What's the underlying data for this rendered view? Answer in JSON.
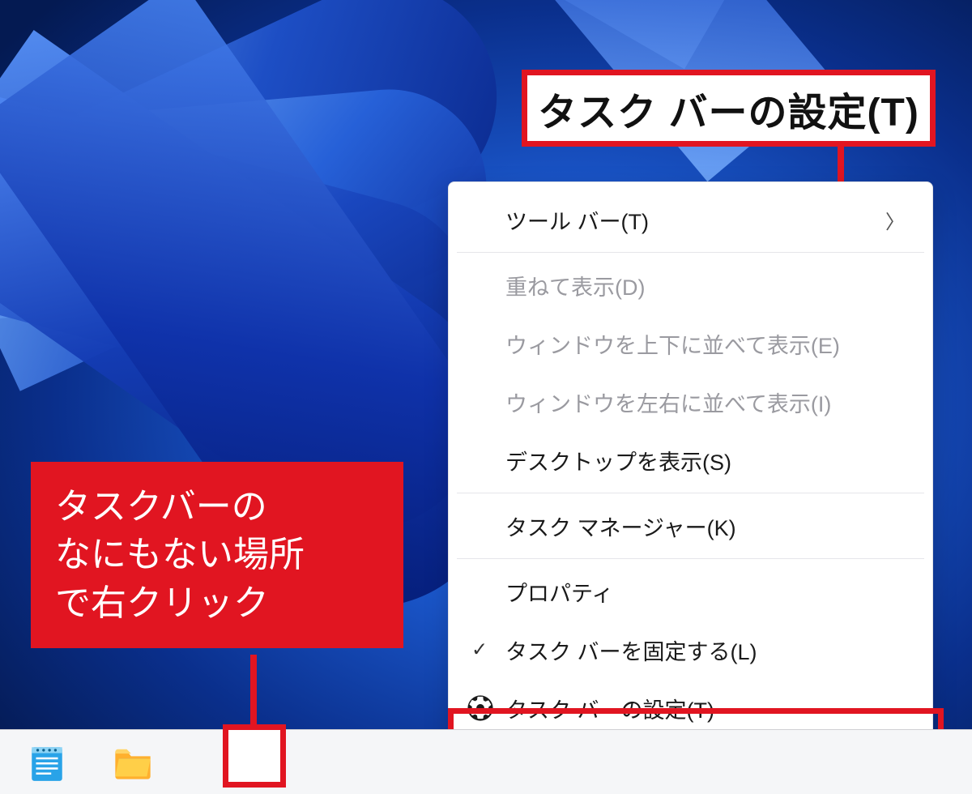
{
  "callouts": {
    "top_zoom_label": "タスク バーの設定(T)",
    "left_instruction": "タスクバーの\nなにもない場所\nで右クリック"
  },
  "context_menu": {
    "toolbars": "ツール バー(T)",
    "cascade": "重ねて表示(D)",
    "stack_vert": "ウィンドウを上下に並べて表示(E)",
    "stack_horiz": "ウィンドウを左右に並べて表示(I)",
    "show_desktop": "デスクトップを表示(S)",
    "task_manager": "タスク マネージャー(K)",
    "properties": "プロパティ",
    "lock_taskbar": "タスク バーを固定する(L)",
    "taskbar_settings": "タスク バーの設定(T)"
  },
  "taskbar": {
    "notepad_icon": "notepad",
    "explorer_icon": "file-explorer"
  }
}
